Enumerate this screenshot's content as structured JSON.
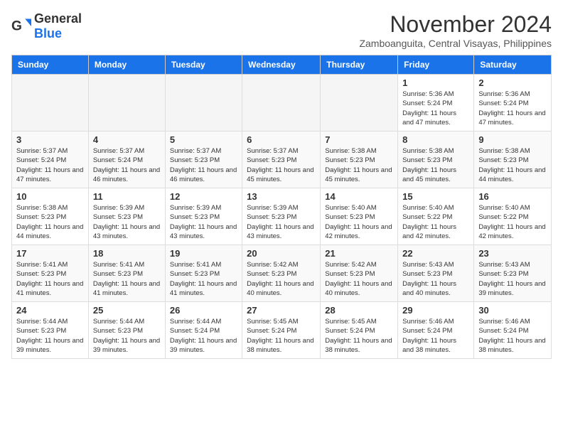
{
  "header": {
    "logo_general": "General",
    "logo_blue": "Blue",
    "month_title": "November 2024",
    "location": "Zamboanguita, Central Visayas, Philippines"
  },
  "weekdays": [
    "Sunday",
    "Monday",
    "Tuesday",
    "Wednesday",
    "Thursday",
    "Friday",
    "Saturday"
  ],
  "weeks": [
    [
      {
        "day": "",
        "info": ""
      },
      {
        "day": "",
        "info": ""
      },
      {
        "day": "",
        "info": ""
      },
      {
        "day": "",
        "info": ""
      },
      {
        "day": "",
        "info": ""
      },
      {
        "day": "1",
        "info": "Sunrise: 5:36 AM\nSunset: 5:24 PM\nDaylight: 11 hours and 47 minutes."
      },
      {
        "day": "2",
        "info": "Sunrise: 5:36 AM\nSunset: 5:24 PM\nDaylight: 11 hours and 47 minutes."
      }
    ],
    [
      {
        "day": "3",
        "info": "Sunrise: 5:37 AM\nSunset: 5:24 PM\nDaylight: 11 hours and 47 minutes."
      },
      {
        "day": "4",
        "info": "Sunrise: 5:37 AM\nSunset: 5:24 PM\nDaylight: 11 hours and 46 minutes."
      },
      {
        "day": "5",
        "info": "Sunrise: 5:37 AM\nSunset: 5:23 PM\nDaylight: 11 hours and 46 minutes."
      },
      {
        "day": "6",
        "info": "Sunrise: 5:37 AM\nSunset: 5:23 PM\nDaylight: 11 hours and 45 minutes."
      },
      {
        "day": "7",
        "info": "Sunrise: 5:38 AM\nSunset: 5:23 PM\nDaylight: 11 hours and 45 minutes."
      },
      {
        "day": "8",
        "info": "Sunrise: 5:38 AM\nSunset: 5:23 PM\nDaylight: 11 hours and 45 minutes."
      },
      {
        "day": "9",
        "info": "Sunrise: 5:38 AM\nSunset: 5:23 PM\nDaylight: 11 hours and 44 minutes."
      }
    ],
    [
      {
        "day": "10",
        "info": "Sunrise: 5:38 AM\nSunset: 5:23 PM\nDaylight: 11 hours and 44 minutes."
      },
      {
        "day": "11",
        "info": "Sunrise: 5:39 AM\nSunset: 5:23 PM\nDaylight: 11 hours and 43 minutes."
      },
      {
        "day": "12",
        "info": "Sunrise: 5:39 AM\nSunset: 5:23 PM\nDaylight: 11 hours and 43 minutes."
      },
      {
        "day": "13",
        "info": "Sunrise: 5:39 AM\nSunset: 5:23 PM\nDaylight: 11 hours and 43 minutes."
      },
      {
        "day": "14",
        "info": "Sunrise: 5:40 AM\nSunset: 5:23 PM\nDaylight: 11 hours and 42 minutes."
      },
      {
        "day": "15",
        "info": "Sunrise: 5:40 AM\nSunset: 5:22 PM\nDaylight: 11 hours and 42 minutes."
      },
      {
        "day": "16",
        "info": "Sunrise: 5:40 AM\nSunset: 5:22 PM\nDaylight: 11 hours and 42 minutes."
      }
    ],
    [
      {
        "day": "17",
        "info": "Sunrise: 5:41 AM\nSunset: 5:23 PM\nDaylight: 11 hours and 41 minutes."
      },
      {
        "day": "18",
        "info": "Sunrise: 5:41 AM\nSunset: 5:23 PM\nDaylight: 11 hours and 41 minutes."
      },
      {
        "day": "19",
        "info": "Sunrise: 5:41 AM\nSunset: 5:23 PM\nDaylight: 11 hours and 41 minutes."
      },
      {
        "day": "20",
        "info": "Sunrise: 5:42 AM\nSunset: 5:23 PM\nDaylight: 11 hours and 40 minutes."
      },
      {
        "day": "21",
        "info": "Sunrise: 5:42 AM\nSunset: 5:23 PM\nDaylight: 11 hours and 40 minutes."
      },
      {
        "day": "22",
        "info": "Sunrise: 5:43 AM\nSunset: 5:23 PM\nDaylight: 11 hours and 40 minutes."
      },
      {
        "day": "23",
        "info": "Sunrise: 5:43 AM\nSunset: 5:23 PM\nDaylight: 11 hours and 39 minutes."
      }
    ],
    [
      {
        "day": "24",
        "info": "Sunrise: 5:44 AM\nSunset: 5:23 PM\nDaylight: 11 hours and 39 minutes."
      },
      {
        "day": "25",
        "info": "Sunrise: 5:44 AM\nSunset: 5:23 PM\nDaylight: 11 hours and 39 minutes."
      },
      {
        "day": "26",
        "info": "Sunrise: 5:44 AM\nSunset: 5:24 PM\nDaylight: 11 hours and 39 minutes."
      },
      {
        "day": "27",
        "info": "Sunrise: 5:45 AM\nSunset: 5:24 PM\nDaylight: 11 hours and 38 minutes."
      },
      {
        "day": "28",
        "info": "Sunrise: 5:45 AM\nSunset: 5:24 PM\nDaylight: 11 hours and 38 minutes."
      },
      {
        "day": "29",
        "info": "Sunrise: 5:46 AM\nSunset: 5:24 PM\nDaylight: 11 hours and 38 minutes."
      },
      {
        "day": "30",
        "info": "Sunrise: 5:46 AM\nSunset: 5:24 PM\nDaylight: 11 hours and 38 minutes."
      }
    ]
  ]
}
